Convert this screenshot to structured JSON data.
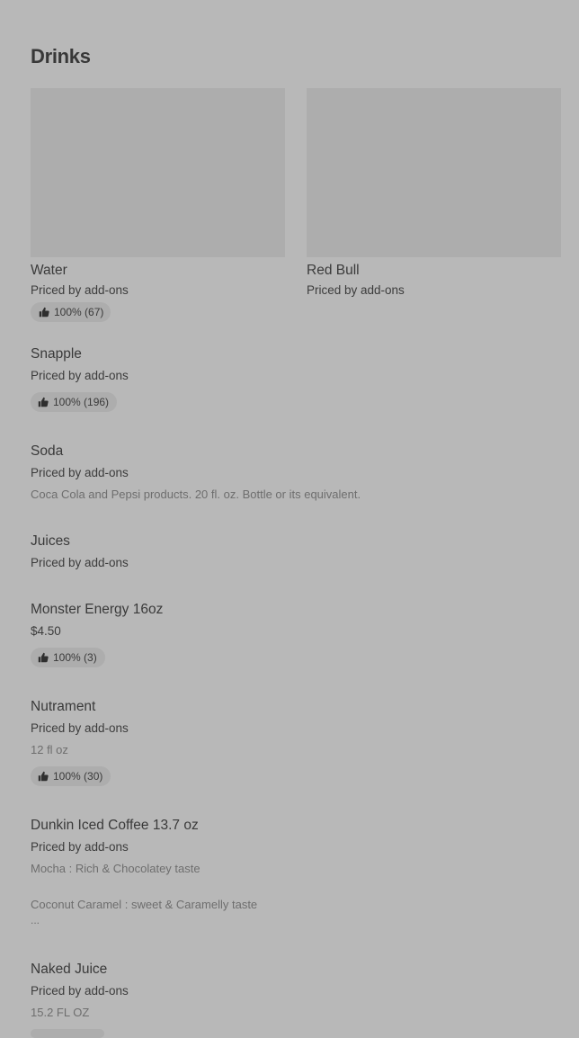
{
  "section": {
    "title": "Drinks"
  },
  "featured": [
    {
      "name": "Water",
      "price": "Priced by add-ons",
      "rating": "100% (67)"
    },
    {
      "name": "Red Bull",
      "price": "Priced by add-ons"
    }
  ],
  "items": [
    {
      "name": "Snapple",
      "price": "Priced by add-ons",
      "rating": "100% (196)"
    },
    {
      "name": "Soda",
      "price": "Priced by add-ons",
      "description": "Coca Cola and Pepsi products. 20 fl. oz. Bottle or its equivalent."
    },
    {
      "name": "Juices",
      "price": "Priced by add-ons"
    },
    {
      "name": "Monster Energy 16oz",
      "price": "$4.50",
      "rating": "100% (3)"
    },
    {
      "name": "Nutrament",
      "price": "Priced by add-ons",
      "description": "12 fl oz",
      "rating": "100% (30)"
    },
    {
      "name": "Dunkin Iced Coffee 13.7 oz",
      "price": "Priced by add-ons",
      "description": "Mocha : Rich & Chocolatey taste",
      "description_more": "Coconut Caramel : sweet & Caramelly taste",
      "truncation": "..."
    },
    {
      "name": "Naked Juice",
      "price": "Priced by add-ons",
      "description": "15.2 FL OZ"
    }
  ],
  "icons": {
    "rating": "thumbs-up-icon"
  },
  "colors": {
    "background": "#b8b8b8",
    "placeholder": "#adadad",
    "text": "#3a3a3a",
    "muted_text": "#6e6e6e"
  }
}
